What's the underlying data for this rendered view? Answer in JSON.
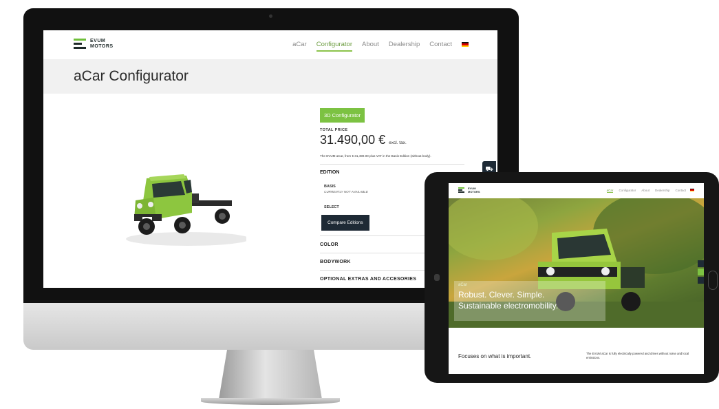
{
  "desktop": {
    "logo": {
      "line1": "EVUM",
      "line2": "MOTORS"
    },
    "nav": [
      {
        "label": "aCar",
        "active": false
      },
      {
        "label": "Configurator",
        "active": true
      },
      {
        "label": "About",
        "active": false
      },
      {
        "label": "Dealership",
        "active": false
      },
      {
        "label": "Contact",
        "active": false
      }
    ],
    "language_flag": "german-flag-icon",
    "page_title": "aCar Configurator",
    "config": {
      "btn_3d": "3D Configurator",
      "price_label": "TOTAL PRICE",
      "price": "31.490,00 €",
      "price_suffix": "excl. tax.",
      "price_note": "The EVUM aCar, from € 31,490.00 plus VAT in the Basis Edition (without body).",
      "edition_heading": "EDITION",
      "edition_name": "BASIS",
      "edition_status": "CURRENTLY NOT AVAILABLE",
      "select_label": "SELECT",
      "compare_label": "Compare Editions",
      "sections": [
        "COLOR",
        "BODYWORK",
        "OPTIONAL EXTRAS AND ACCESORIES"
      ]
    },
    "side_widget_icon": "truck-icon"
  },
  "tablet": {
    "logo": {
      "line1": "EVUM",
      "line2": "MOTORS"
    },
    "nav": [
      {
        "label": "aCar",
        "active": true
      },
      {
        "label": "Configurator",
        "active": false
      },
      {
        "label": "About",
        "active": false
      },
      {
        "label": "Dealership",
        "active": false
      },
      {
        "label": "Contact",
        "active": false
      }
    ],
    "hero": {
      "eyebrow": "aCar",
      "line1": "Robust. Clever. Simple.",
      "line2": "Sustainable electromobility."
    },
    "focus_title": "Focuses on what is important.",
    "focus_text": "The EVUM aCar is fully electrically powered and drives without noise and local emissions."
  },
  "colors": {
    "brand_green": "#7cc242",
    "dark_navy": "#1e2a35",
    "vehicle_green": "#8dc63f"
  }
}
